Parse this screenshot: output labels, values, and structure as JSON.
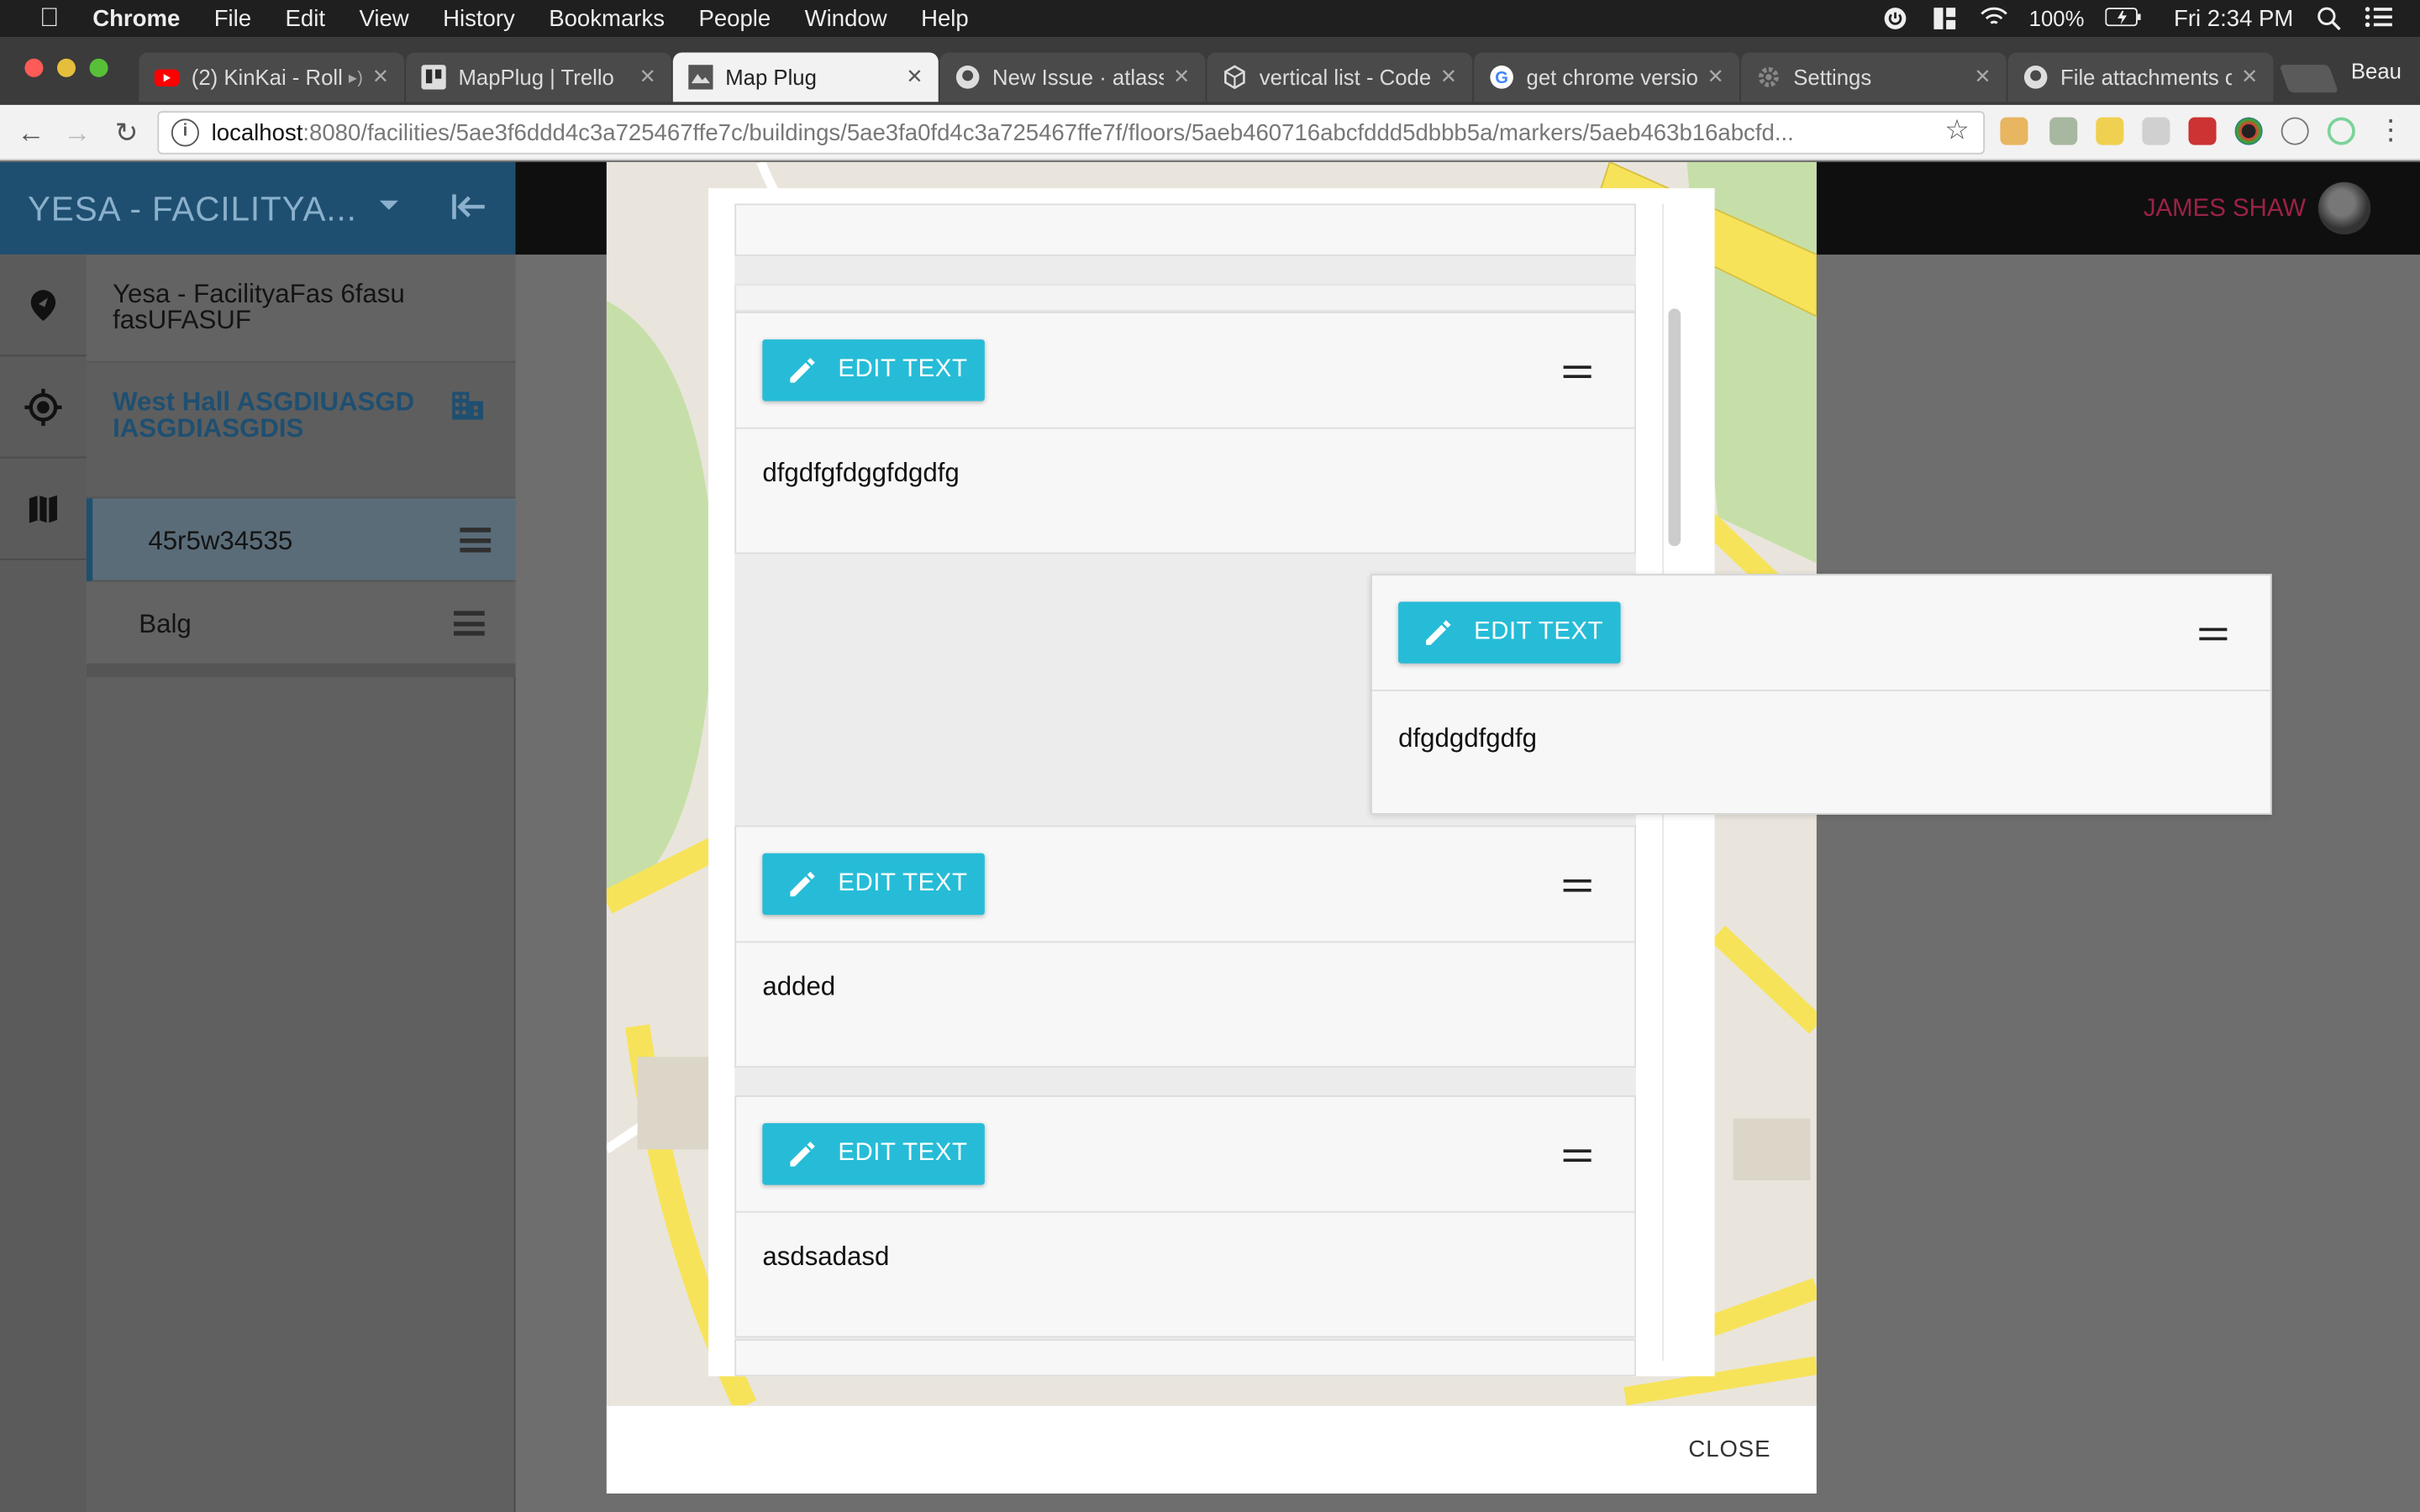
{
  "menubar": {
    "app": "Chrome",
    "items": [
      "File",
      "Edit",
      "View",
      "History",
      "Bookmarks",
      "People",
      "Window",
      "Help"
    ],
    "battery": "100%",
    "clock": "Fri 2:34 PM"
  },
  "tabs": [
    {
      "label": "(2) KinKai - Roll",
      "favicon": "youtube-icon",
      "color": "#ff0000"
    },
    {
      "label": "MapPlug | Trello",
      "favicon": "trello-icon",
      "color": "#2b6aa8"
    },
    {
      "label": "Map Plug",
      "favicon": "map-plug-icon",
      "color": "#666666",
      "active": true
    },
    {
      "label": "New Issue · atlassi",
      "favicon": "github-icon",
      "color": "#dddddd"
    },
    {
      "label": "vertical list - Code",
      "favicon": "codesandbox-icon",
      "color": "#dddddd"
    },
    {
      "label": "get chrome versio",
      "favicon": "google-icon",
      "color": "#4285f4"
    },
    {
      "label": "Settings",
      "favicon": "gear-icon",
      "color": "#888888"
    },
    {
      "label": "File attachments o",
      "favicon": "github-icon",
      "color": "#dddddd"
    }
  ],
  "profile_name": "Beau",
  "address": {
    "host": "localhost",
    "path": ":8080/facilities/5ae3f6ddd4c3a725467ffe7c/buildings/5ae3fa0fd4c3a725467ffe7f/floors/5aeb460716abcfddd5dbbb5a/markers/5aeb463b16abcfd..."
  },
  "header": {
    "facility_title": "YESA - FACILITYA...",
    "user_name": "JAMES SHAW"
  },
  "sidebar": {
    "facility_name": "Yesa - FacilityaFas 6fasu fasUFASUF",
    "building_name": "West Hall ASGDIUASGD IASGDIASGDIS",
    "floors": [
      {
        "label": "45r5w34535",
        "selected": true
      },
      {
        "label": "Balg",
        "selected": false
      }
    ]
  },
  "modal": {
    "edit_label": "EDIT TEXT",
    "cards": [
      {
        "text": "dfgdfgfdggfdgdfg"
      },
      {
        "text": "added"
      },
      {
        "text": "asdsadasd"
      }
    ],
    "dragging_card": {
      "text": "dfgdgdfgdfg"
    },
    "close_label": "CLOSE"
  },
  "colors": {
    "accent_button": "#26bcd7",
    "header_blue": "#1f4f70",
    "user_name": "#9c2247"
  }
}
